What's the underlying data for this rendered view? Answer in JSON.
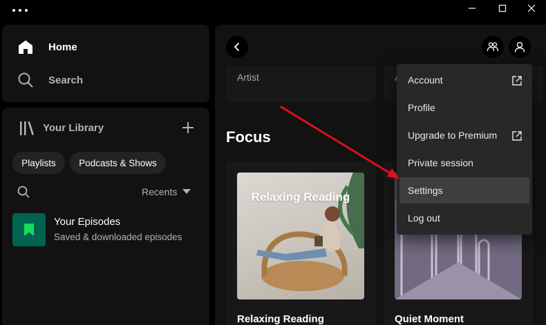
{
  "nav": {
    "home_label": "Home",
    "search_label": "Search"
  },
  "library": {
    "title": "Your Library",
    "chips": [
      "Playlists",
      "Podcasts & Shows"
    ],
    "sort_label": "Recents",
    "items": [
      {
        "title": "Your Episodes",
        "subtitle": "Saved & downloaded episodes"
      }
    ]
  },
  "main": {
    "top_cards": [
      "Artist",
      "A"
    ],
    "section_title": "Focus",
    "cards": [
      {
        "title": "Relaxing Reading",
        "cover_text": "Relaxing Reading"
      },
      {
        "title": "Quiet Moment"
      }
    ]
  },
  "profile_menu": {
    "items": [
      {
        "label": "Account",
        "external": true
      },
      {
        "label": "Profile",
        "external": false
      },
      {
        "label": "Upgrade to Premium",
        "external": true
      },
      {
        "label": "Private session",
        "external": false
      },
      {
        "label": "Settings",
        "external": false,
        "highlighted": true
      },
      {
        "label": "Log out",
        "external": false
      }
    ]
  },
  "colors": {
    "accent_green": "#1ed760",
    "episodes_tile": "#006450",
    "annotation_arrow": "#e0101a"
  },
  "icons": {
    "home": "home-icon",
    "search": "search-icon",
    "library": "library-icon",
    "plus": "plus-icon",
    "back": "chevron-left-icon",
    "friends": "friends-icon",
    "profile": "user-icon",
    "external": "external-link-icon",
    "bookmark": "bookmark-icon"
  }
}
